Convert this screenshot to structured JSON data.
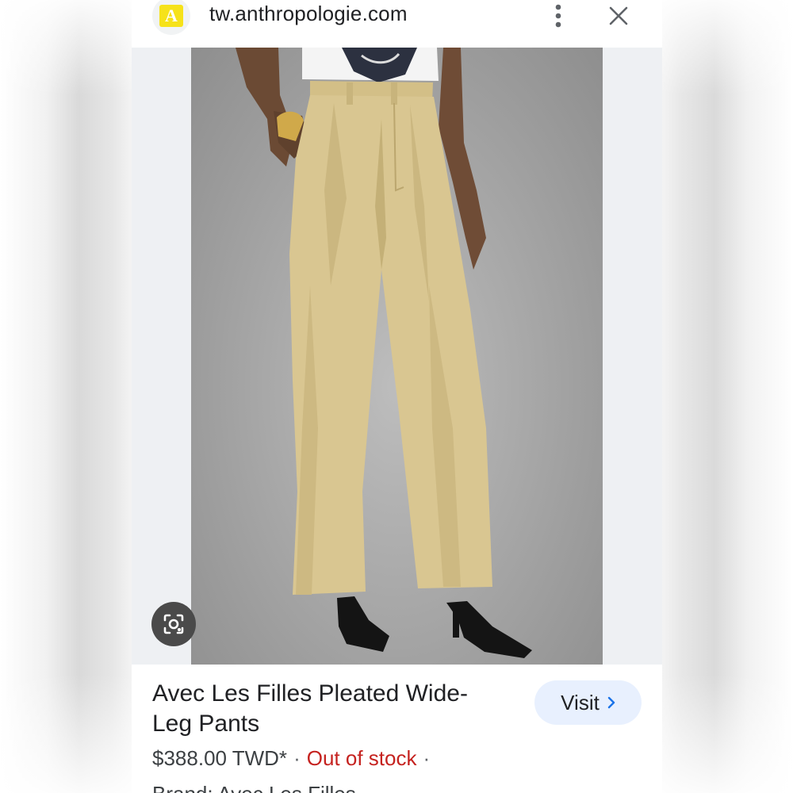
{
  "browser": {
    "favicon_letter": "A",
    "url": "tw.anthropologie.com",
    "more_icon": "more-vert-icon",
    "close_icon": "close-icon"
  },
  "product": {
    "title": "Avec Les Filles Pleated Wide-Leg Pants",
    "price": "$388.00 TWD*",
    "separator": "·",
    "stock_status": "Out of stock",
    "brand_line": "Brand: Avec Les Filles",
    "visit_label": "Visit",
    "visit_icon": "chevron-right-icon",
    "lens_icon": "google-lens-icon"
  },
  "colors": {
    "favicon_bg": "#f6e21a",
    "out_of_stock": "#c5221f",
    "visit_bg": "#e8f0fe",
    "visit_chevron": "#1a73e8",
    "pants": "#d9c691"
  }
}
